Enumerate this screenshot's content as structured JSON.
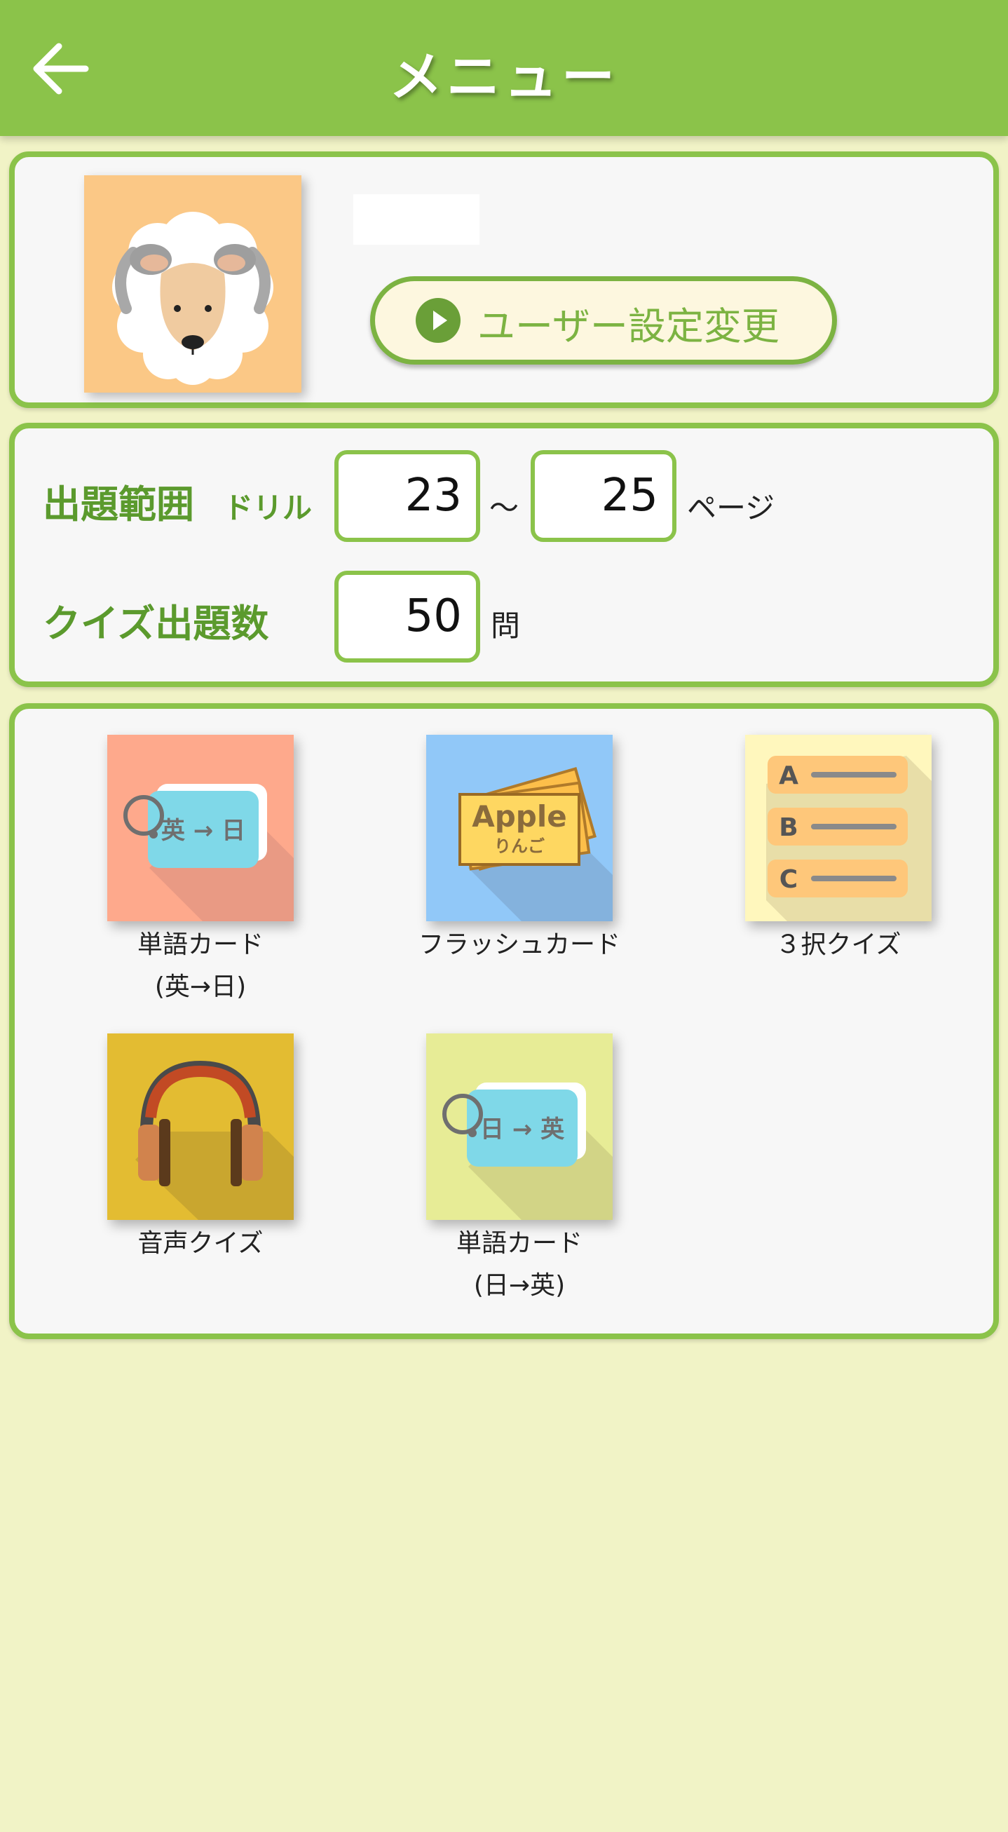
{
  "header": {
    "title": "メニュー",
    "back_icon": "arrow-left-icon"
  },
  "user": {
    "name": "",
    "avatar_icon": "sheep-icon",
    "settings_button_label": "ユーザー設定変更",
    "settings_button_icon": "play-circle-icon"
  },
  "range": {
    "label": "出題範囲",
    "drill_label": "ドリル",
    "from": "23",
    "separator": "～",
    "to": "25",
    "page_unit": "ページ"
  },
  "quiz": {
    "count_label": "クイズ出題数",
    "count": "50",
    "count_unit": "問"
  },
  "modes": [
    {
      "line1": "単語カード",
      "line2": "(英→日)",
      "icon_text": "英 → 日",
      "icon": "word-card-en-ja-icon"
    },
    {
      "line1": "フラッシュカード",
      "line2": "",
      "icon_text": "Apple",
      "icon_sub": "りんご",
      "icon": "flash-card-icon"
    },
    {
      "line1": "３択クイズ",
      "line2": "",
      "icon": "three-choice-quiz-icon",
      "choices": [
        "A",
        "B",
        "C"
      ]
    },
    {
      "line1": "音声クイズ",
      "line2": "",
      "icon": "headphones-icon"
    },
    {
      "line1": "単語カード",
      "line2": "(日→英)",
      "icon_text": "日 → 英",
      "icon": "word-card-ja-en-icon"
    }
  ],
  "colors": {
    "primary": "#8bc34a",
    "background": "#f1f3c6",
    "accent_text": "#5b9a2d"
  }
}
